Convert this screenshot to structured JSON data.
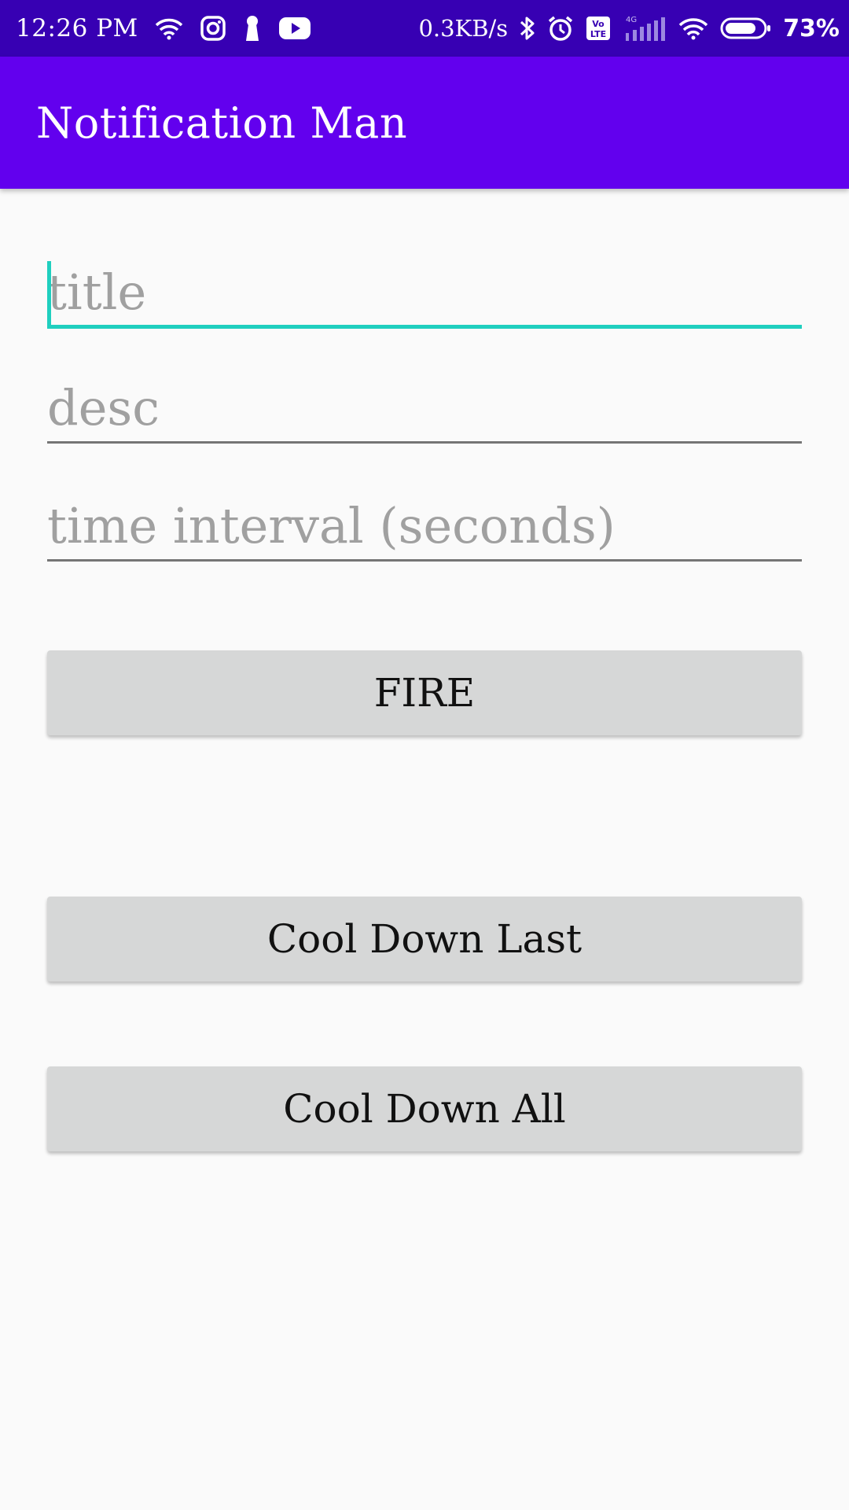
{
  "status_bar": {
    "time": "12:26 PM",
    "net_speed": "0.3KB/s",
    "battery_percent": "73%",
    "left_icons": [
      "wifi-icon",
      "instagram-icon",
      "keyhole-icon",
      "youtube-icon"
    ],
    "right_icons": [
      "bluetooth-icon",
      "alarm-icon",
      "volte-icon",
      "signal-4g-icon",
      "wifi-icon",
      "battery-icon"
    ],
    "volte_label": "Vo LTE",
    "network_type": "4G"
  },
  "app_bar": {
    "title": "Notification Man",
    "color": "#6200ee"
  },
  "form": {
    "title_field": {
      "value": "",
      "placeholder": "title",
      "focused": true
    },
    "desc_field": {
      "value": "",
      "placeholder": "desc"
    },
    "interval_field": {
      "value": "",
      "placeholder": "time interval (seconds)"
    }
  },
  "buttons": {
    "fire": "FIRE",
    "cool_down_last": "Cool Down Last",
    "cool_down_all": "Cool Down All"
  },
  "colors": {
    "status_bar": "#3700b3",
    "accent": "#1fcfbf",
    "button_bg": "#d6d7d7",
    "background": "#fafafa"
  }
}
